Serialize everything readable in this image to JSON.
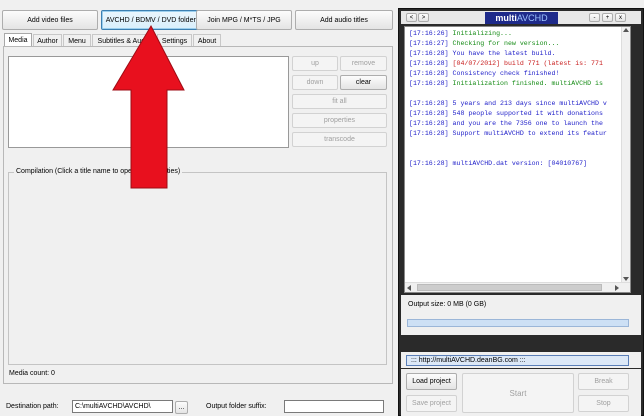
{
  "toolbar": {
    "add_video": "Add video files",
    "avchd_folders": "AVCHD / BDMV / DVD folders",
    "join": "Join MPG / M*TS / JPG",
    "add_audio": "Add audio titles"
  },
  "tabs": [
    "Media",
    "Author",
    "Menu",
    "Subtitles & Audio",
    "Settings",
    "About"
  ],
  "media_buttons": {
    "up": "up",
    "remove": "remove",
    "down": "down",
    "clear": "clear",
    "fit_all": "fit all",
    "properties": "properties",
    "transcode": "transcode"
  },
  "compilation_label": "Compilation (Click a title name to open its properties)",
  "media_count": "Media count: 0",
  "destination": {
    "label": "Destination path:",
    "value": "C:\\multiAVCHD\\AVCHD\\",
    "browse": "..."
  },
  "output_suffix": {
    "label": "Output folder suffix:",
    "value": ""
  },
  "right_panel": {
    "nav_prev": "<",
    "nav_next": ">",
    "logo_multi": "multi",
    "logo_avchd": "AVCHD",
    "win_min": "-",
    "win_max": "+",
    "win_close": "x",
    "log": [
      {
        "time": "[17:16:26]",
        "text": "Initializing...",
        "color": "#138a13"
      },
      {
        "time": "[17:16:27]",
        "text": "Checking for new version...",
        "color": "#138a13"
      },
      {
        "time": "[17:16:28]",
        "text": "You have the latest build.",
        "color": "#1c1cc8"
      },
      {
        "time": "[17:16:28]",
        "text": "[04/07/2012] build 771 (latest is: 771",
        "color": "#c81c1c"
      },
      {
        "time": "[17:16:28]",
        "text": "Consistency check finished!",
        "color": "#1c1cc8"
      },
      {
        "time": "[17:16:28]",
        "text": "Initialization finished. multiAVCHD is",
        "color": "#138a13"
      },
      {
        "blank": true
      },
      {
        "time": "[17:16:28]",
        "text": "5 years and 213 days since multiAVCHD v",
        "color": "#1c1cc8"
      },
      {
        "time": "[17:16:28]",
        "text": "548 people supported it with donations",
        "color": "#1c1cc8"
      },
      {
        "time": "[17:16:28]",
        "text": "and you are the 7356 one to launch the",
        "color": "#1c1cc8"
      },
      {
        "time": "[17:16:28]",
        "text": "Support multiAVCHD to extend its featur",
        "color": "#1c1cc8"
      },
      {
        "blank": true
      },
      {
        "blank": true
      },
      {
        "time": "[17:16:28]",
        "text": "multiAVCHD.dat version: [04010767]",
        "color": "#1c1cc8"
      }
    ],
    "output_size": "Output size: 0 MB (0 GB)",
    "url": "::: http://multiAVCHD.deanBG.com :::",
    "load_project": "Load project",
    "save_project": "Save project",
    "start": "Start",
    "break": "Break",
    "stop": "Stop"
  },
  "colors": {
    "arrow": "#e8101e",
    "logo_bg": "#1e2a8a",
    "progress": "#cde0f5",
    "url_bg": "#dce8f7"
  }
}
